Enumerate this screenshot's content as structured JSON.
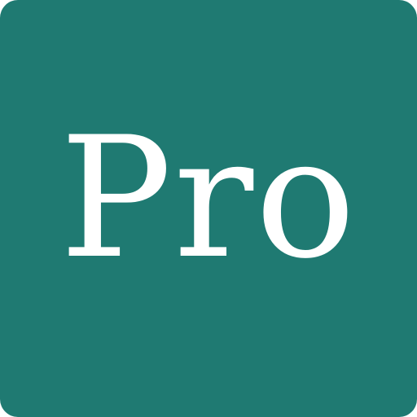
{
  "icon": {
    "label": "Pro",
    "background_color": "#1f7a72",
    "text_color": "#ffffff"
  }
}
